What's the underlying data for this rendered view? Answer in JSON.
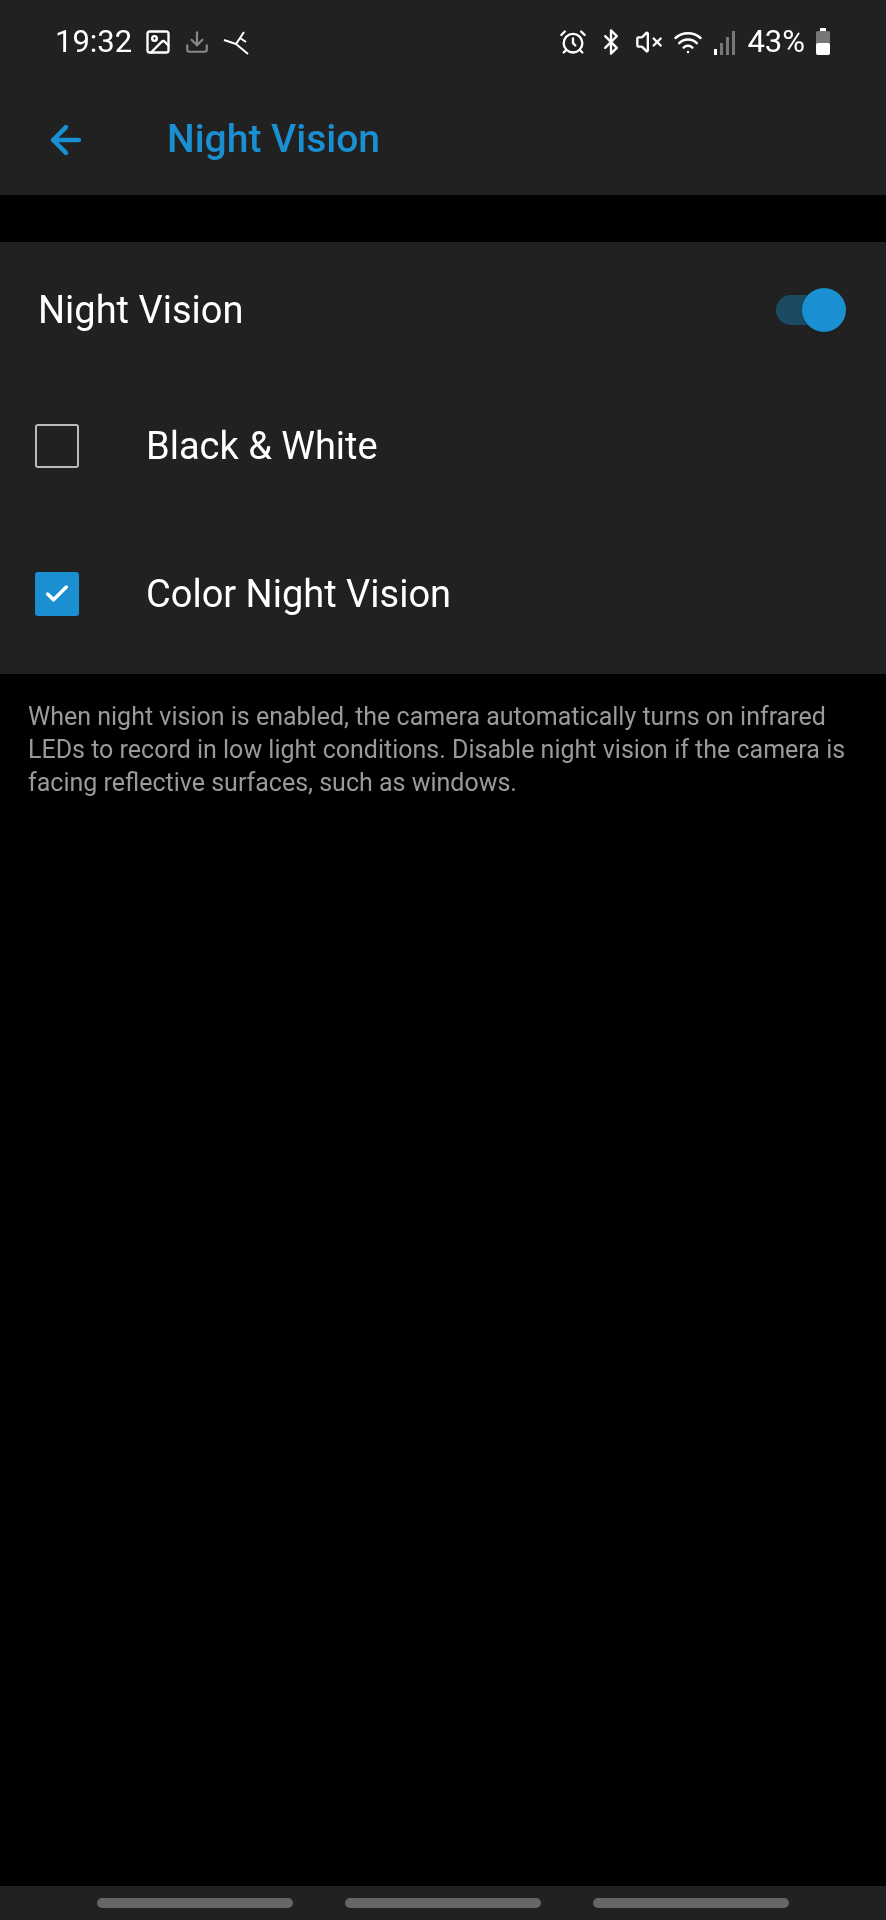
{
  "status_bar": {
    "time": "19:32",
    "battery": "43%"
  },
  "header": {
    "title": "Night Vision"
  },
  "settings": [
    {
      "kind": "toggle",
      "label": "Night Vision",
      "on": true
    },
    {
      "kind": "checkbox",
      "label": "Black & White",
      "checked": false
    },
    {
      "kind": "checkbox",
      "label": "Color Night Vision",
      "checked": true
    }
  ],
  "description": "When night vision is enabled, the camera automatically turns on infrared LEDs to record in low light conditions. Disable night vision if the camera is facing reflective surfaces, such as windows."
}
